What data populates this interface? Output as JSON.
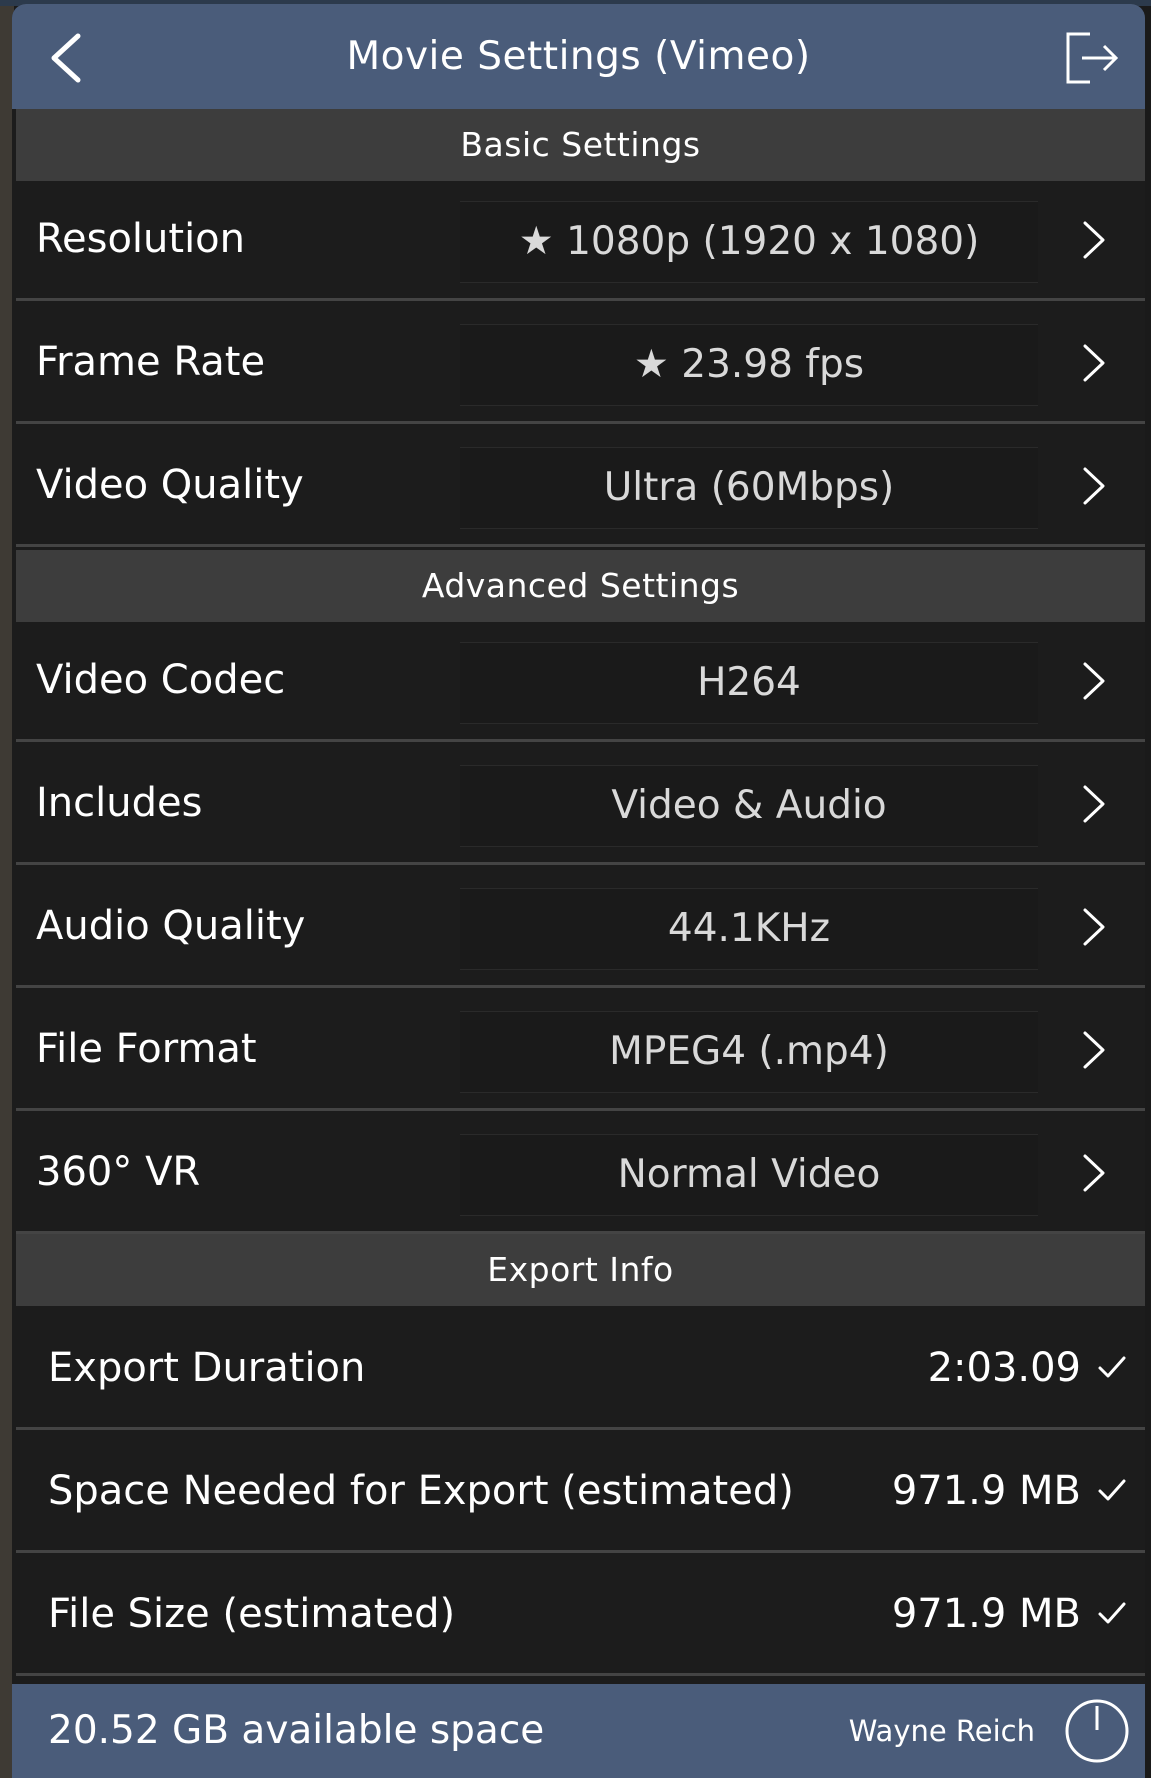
{
  "header": {
    "title": "Movie Settings (Vimeo)"
  },
  "sections": {
    "basic": "Basic Settings",
    "advanced": "Advanced Settings",
    "export_info": "Export Info"
  },
  "basic_rows": [
    {
      "label": "Resolution",
      "value": "1080p (1920 x 1080)",
      "starred": true
    },
    {
      "label": "Frame Rate",
      "value": "23.98 fps",
      "starred": true
    },
    {
      "label": "Video Quality",
      "value": "Ultra (60Mbps)",
      "starred": false
    }
  ],
  "advanced_rows": [
    {
      "label": "Video Codec",
      "value": "H264"
    },
    {
      "label": "Includes",
      "value": "Video & Audio"
    },
    {
      "label": "Audio Quality",
      "value": "44.1KHz"
    },
    {
      "label": "File Format",
      "value": "MPEG4 (.mp4)"
    },
    {
      "label": "360° VR",
      "value": "Normal Video"
    }
  ],
  "export_rows": [
    {
      "label": "Export Duration",
      "value": "2:03.09"
    },
    {
      "label": "Space Needed for Export (estimated)",
      "value": "971.9 MB"
    },
    {
      "label": "File Size (estimated)",
      "value": "971.9 MB"
    }
  ],
  "footer": {
    "available_space": "20.52 GB available space",
    "user_name": "Wayne Reich"
  },
  "icons": {
    "star": "★"
  },
  "colors": {
    "header_bg": "#4a5c7a",
    "section_bg": "#3d3d3d",
    "row_bg": "#1c1c1c"
  }
}
